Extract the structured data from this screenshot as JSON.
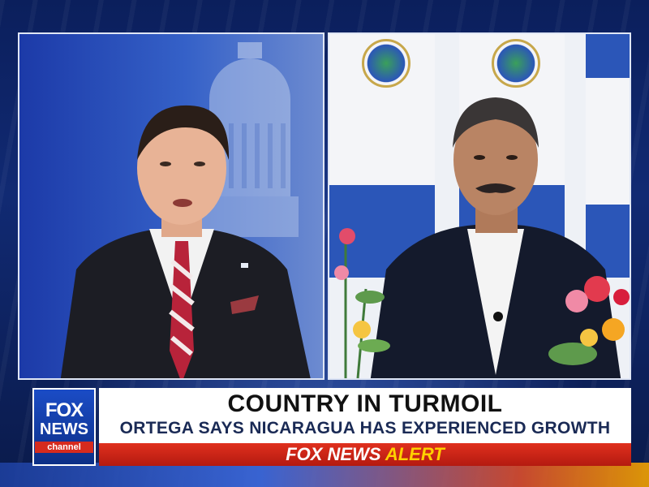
{
  "lower_third": {
    "headline": "COUNTRY IN TURMOIL",
    "subline": "ORTEGA SAYS NICARAGUA HAS EXPERIENCED GROWTH",
    "alert_network": "FOX NEWS",
    "alert_word": "ALERT"
  },
  "logo": {
    "line1": "FOX",
    "line2": "NEWS",
    "line3": "channel"
  },
  "colors": {
    "brand_blue": "#1b4cc6",
    "alert_red": "#d62b1e",
    "alert_yellow": "#ffd000",
    "flag_blue": "#2b56b8"
  }
}
